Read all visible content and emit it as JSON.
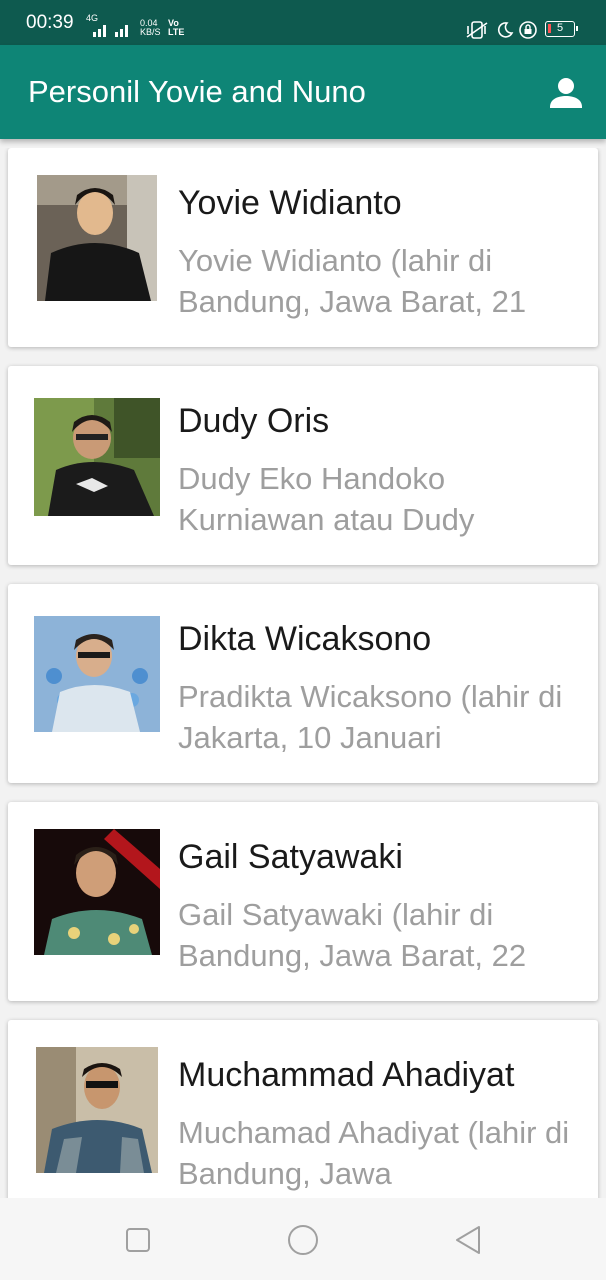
{
  "status_bar": {
    "time": "00:39",
    "network": "4G",
    "speed": "0.04",
    "speed_unit": "KB/S",
    "volte_top": "Vo",
    "volte_bottom": "LTE",
    "battery": "5"
  },
  "app_bar": {
    "title": "Personil Yovie and Nuno",
    "action_icon": "person-icon"
  },
  "members": [
    {
      "name": "Yovie Widianto",
      "description": "Yovie Widianto (lahir di Bandung, Jawa Barat, 21"
    },
    {
      "name": "Dudy Oris",
      "description": "Dudy Eko Handoko Kurniawan atau Dudy"
    },
    {
      "name": "Dikta Wicaksono",
      "description": "Pradikta Wicaksono (lahir di Jakarta, 10 Januari"
    },
    {
      "name": "Gail Satyawaki",
      "description": "Gail Satyawaki (lahir di Bandung, Jawa Barat, 22"
    },
    {
      "name": "Muchammad Ahadiyat",
      "description": "Muchamad Ahadiyat (lahir di Bandung, Jawa"
    }
  ],
  "nav_bar": {
    "icons": [
      "recent-apps-icon",
      "home-icon",
      "back-icon"
    ]
  },
  "colors": {
    "status_bar": "#0e5a4f",
    "app_bar": "#0e8576",
    "background": "#f2f2f2",
    "card": "#ffffff",
    "name_text": "#1a1a1a",
    "description_text": "#9e9e9e"
  }
}
